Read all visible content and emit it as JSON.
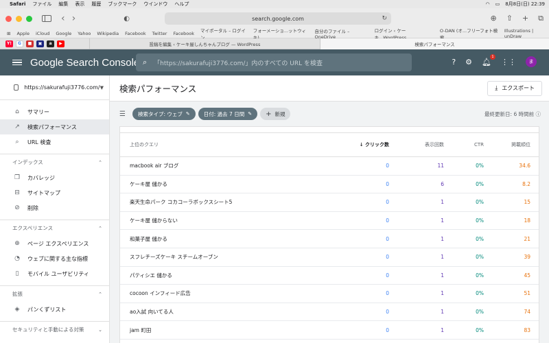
{
  "mac_menu": {
    "apple": "",
    "items": [
      "Safari",
      "ファイル",
      "編集",
      "表示",
      "履歴",
      "ブックマーク",
      "ウインドウ",
      "ヘルプ"
    ],
    "datetime": "8月8日(日) 22:39"
  },
  "safari": {
    "url": "search.google.com"
  },
  "favorites": [
    "Apple",
    "iCloud",
    "Google",
    "Yahoo",
    "Wikipedia",
    "Facebook",
    "Twitter",
    "Facebook",
    "マイポータル – ログイン",
    "フォーメーショ...ットウィキ)",
    "自分のファイル – OneDrive",
    "ログイン ‹ ケーキ...WordPress",
    "O-DAN (オ...フリーフォト検索",
    "Illustrations | unDraw"
  ],
  "tabs": {
    "fav_icons": [
      "Y!",
      "G",
      "■",
      "▣",
      "a",
      "▶"
    ],
    "tab1": "投稿を編集 ‹ ケーキ屋しんちゃんブログ — WordPress",
    "tab2": "検索パフォーマンス"
  },
  "header": {
    "title": "Google Search Console",
    "search_placeholder": "「https://sakurafuji3776.com/」内のすべての URL を検査",
    "notification_count": "1",
    "avatar_letter": "ま"
  },
  "sidebar": {
    "property": "https://sakurafuji3776.com/",
    "top_items": [
      {
        "label": "サマリー",
        "icon": "home-icon"
      },
      {
        "label": "検索パフォーマンス",
        "icon": "trending-icon"
      },
      {
        "label": "URL 検査",
        "icon": "search-icon"
      }
    ],
    "index_section": "インデックス",
    "index_items": [
      {
        "label": "カバレッジ",
        "icon": "file-copy-icon"
      },
      {
        "label": "サイトマップ",
        "icon": "sitemap-icon"
      },
      {
        "label": "削除",
        "icon": "eye-off-icon"
      }
    ],
    "experience_section": "エクスペリエンス",
    "experience_items": [
      {
        "label": "ページ エクスペリエンス",
        "icon": "plus-circle-icon"
      },
      {
        "label": "ウェブに関する主な指標",
        "icon": "gauge-icon"
      },
      {
        "label": "モバイル ユーザビリティ",
        "icon": "phone-icon"
      }
    ],
    "enhancements_section": "拡張",
    "enhancement_items": [
      {
        "label": "パンくずリスト",
        "icon": "layers-icon"
      }
    ],
    "security_section": "セキュリティと手動による対策"
  },
  "main": {
    "title": "検索パフォーマンス",
    "export_label": "エクスポート",
    "filters": {
      "search_type": "検索タイプ: ウェブ",
      "date": "日付: 過去 7 日間",
      "new": "新規"
    },
    "last_updated": "最終更新日: 6 時間前",
    "table": {
      "headers": {
        "query": "上位のクエリ",
        "clicks": "クリック数",
        "impressions": "表示回数",
        "ctr": "CTR",
        "position": "掲載順位"
      },
      "rows": [
        {
          "query": "macbook air ブログ",
          "clicks": "0",
          "impressions": "11",
          "ctr": "0%",
          "position": "34.6"
        },
        {
          "query": "ケーキ屋 儲かる",
          "clicks": "0",
          "impressions": "6",
          "ctr": "0%",
          "position": "8.2"
        },
        {
          "query": "楽天生命パーク コカコーラボックスシート5",
          "clicks": "0",
          "impressions": "1",
          "ctr": "0%",
          "position": "15"
        },
        {
          "query": "ケーキ屋 儲からない",
          "clicks": "0",
          "impressions": "1",
          "ctr": "0%",
          "position": "18"
        },
        {
          "query": "和菓子屋 儲かる",
          "clicks": "0",
          "impressions": "1",
          "ctr": "0%",
          "position": "21"
        },
        {
          "query": "スフレチーズケーキ スチームオーブン",
          "clicks": "0",
          "impressions": "1",
          "ctr": "0%",
          "position": "39"
        },
        {
          "query": "パティシエ 儲かる",
          "clicks": "0",
          "impressions": "1",
          "ctr": "0%",
          "position": "45"
        },
        {
          "query": "cocoon インフィード広告",
          "clicks": "0",
          "impressions": "1",
          "ctr": "0%",
          "position": "51"
        },
        {
          "query": "ao入試 向いてる人",
          "clicks": "0",
          "impressions": "1",
          "ctr": "0%",
          "position": "74"
        },
        {
          "query": "jam 町田",
          "clicks": "0",
          "impressions": "1",
          "ctr": "0%",
          "position": "83"
        }
      ]
    }
  },
  "colors": {
    "header_bg": "#455a64",
    "clicks": "#4285f4",
    "impressions": "#5e35b1",
    "ctr": "#00897b",
    "position": "#e8710a"
  }
}
